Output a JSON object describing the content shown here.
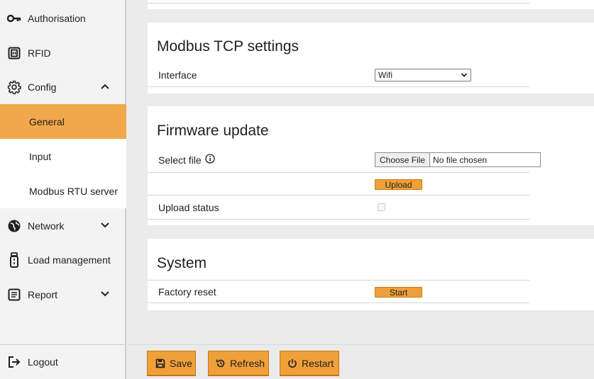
{
  "sidebar": {
    "items": [
      {
        "label": "Authorisation",
        "icon": "key-icon"
      },
      {
        "label": "RFID",
        "icon": "rfid-icon"
      },
      {
        "label": "Config",
        "icon": "gear-icon",
        "expanded": true
      },
      {
        "label": "Network",
        "icon": "globe-icon"
      },
      {
        "label": "Load management",
        "icon": "plug-icon"
      },
      {
        "label": "Report",
        "icon": "document-icon"
      }
    ],
    "config_children": [
      {
        "label": "General",
        "active": true
      },
      {
        "label": "Input"
      },
      {
        "label": "Modbus RTU server"
      }
    ],
    "logout": {
      "label": "Logout",
      "icon": "logout-icon"
    }
  },
  "modbus_tcp": {
    "title": "Modbus TCP settings",
    "interface_label": "Interface",
    "interface_value": "Wifi"
  },
  "firmware": {
    "title": "Firmware update",
    "select_file_label": "Select file",
    "choose_file_label": "Choose File",
    "file_status": "No file chosen",
    "upload_label": "Upload",
    "upload_status_label": "Upload status"
  },
  "system": {
    "title": "System",
    "factory_reset_label": "Factory reset",
    "start_label": "Start"
  },
  "footer": {
    "save_label": "Save",
    "refresh_label": "Refresh",
    "restart_label": "Restart"
  },
  "colors": {
    "accent": "#f0a038",
    "active_nav": "#f0a84b"
  }
}
